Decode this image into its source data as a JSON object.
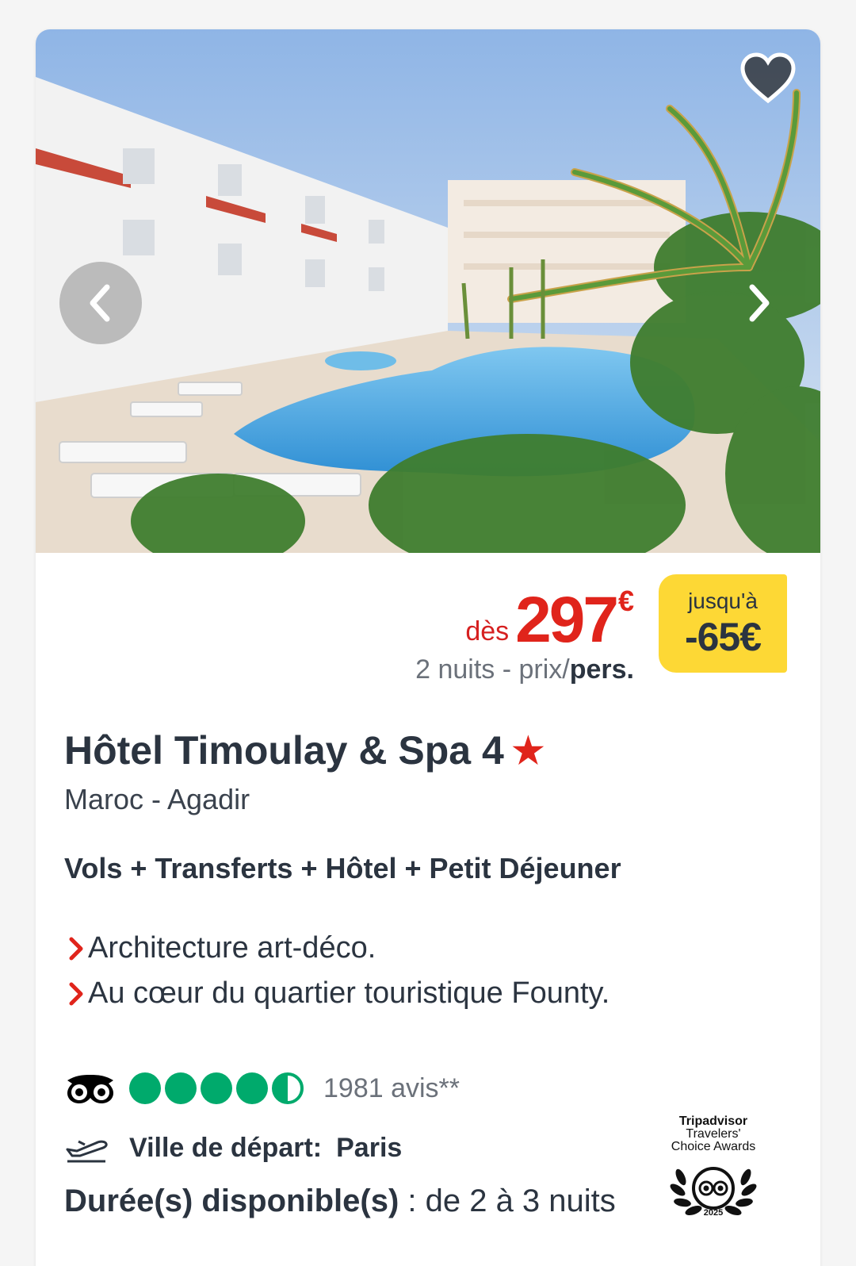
{
  "hotel": {
    "name": "Hôtel Timoulay & Spa 4",
    "star_glyph": "★",
    "location": "Maroc - Agadir",
    "package": "Vols + Transferts + Hôtel + Petit Déjeuner",
    "highlights": [
      "Architecture art-déco.",
      "Au cœur du quartier touristique Founty."
    ]
  },
  "price": {
    "from_label": "dès",
    "amount": "297",
    "currency": "€",
    "subtitle_prefix": "2 nuits - prix/",
    "subtitle_bold": "pers."
  },
  "discount": {
    "label": "jusqu'à",
    "value": "-65€"
  },
  "rating": {
    "filled_bubbles": 4.5,
    "max_bubbles": 5,
    "reviews": "1981 avis**"
  },
  "departure": {
    "label": "Ville de départ:",
    "city": "Paris"
  },
  "duration": {
    "label": "Durée(s) disponible(s)",
    "value": " : de 2 à 3 nuits"
  },
  "award": {
    "line1": "Tripadvisor",
    "line2": "Travelers'",
    "line3": "Choice Awards",
    "year": "2025"
  },
  "colors": {
    "price_red": "#e0241b",
    "discount_yellow": "#fdd835",
    "tripadvisor_green": "#00aa6c",
    "text_dark": "#2b3440"
  },
  "icons": {
    "favorite": "heart-icon",
    "prev": "chevron-left-icon",
    "next": "chevron-right-icon",
    "bullet": "chevron-right-red-icon",
    "tripadvisor": "tripadvisor-owl-icon",
    "departure": "plane-takeoff-icon"
  }
}
